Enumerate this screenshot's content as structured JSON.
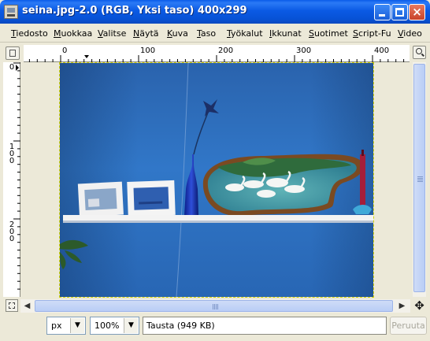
{
  "window": {
    "title": "seina.jpg-2.0 (RGB, Yksi taso) 400x299",
    "close_glyph": "×"
  },
  "menu": [
    "Tiedosto",
    "Muokkaa",
    "Valitse",
    "Näytä",
    "Kuva",
    "Taso",
    "Työkalut",
    "Ikkunat",
    "Suotimet",
    "Script-Fu",
    "Video"
  ],
  "rulers": {
    "horizontal_ticks": [
      "0",
      "100",
      "200",
      "300",
      "400"
    ],
    "vertical_ticks": [
      [
        "0"
      ],
      [
        "1",
        "0",
        "0"
      ],
      [
        "2",
        "0",
        "0"
      ]
    ]
  },
  "image": {
    "file": "seina.jpg",
    "description_colors": {
      "wall": "#2e6fbd",
      "shelf": "#f2f2f2"
    }
  },
  "statusbar": {
    "unit": "px",
    "zoom": "100%",
    "message": "Tausta (949 KB)",
    "cancel_label": "Peruuta",
    "dropdown_glyph": "▼"
  },
  "scroll": {
    "left_arrow": "◀",
    "right_arrow": "▶",
    "move_glyph": "✥"
  }
}
